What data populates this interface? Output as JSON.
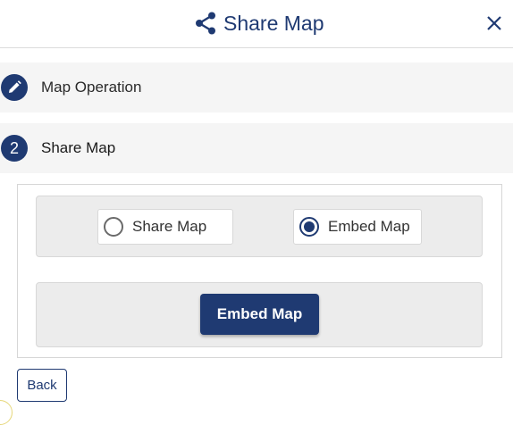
{
  "header": {
    "title": "Share Map",
    "icon": "share-icon",
    "close_icon": "close-icon"
  },
  "steps": [
    {
      "marker": "pencil-icon",
      "label": "Map Operation"
    },
    {
      "marker": "2",
      "label": "Share Map"
    }
  ],
  "share_options": {
    "items": [
      {
        "label": "Share Map",
        "selected": false
      },
      {
        "label": "Embed Map",
        "selected": true
      }
    ]
  },
  "actions": {
    "primary_label": "Embed Map",
    "back_label": "Back"
  },
  "colors": {
    "accent": "#1f3a72",
    "panel_bg": "#ececec",
    "row_bg": "#f5f5f5"
  }
}
